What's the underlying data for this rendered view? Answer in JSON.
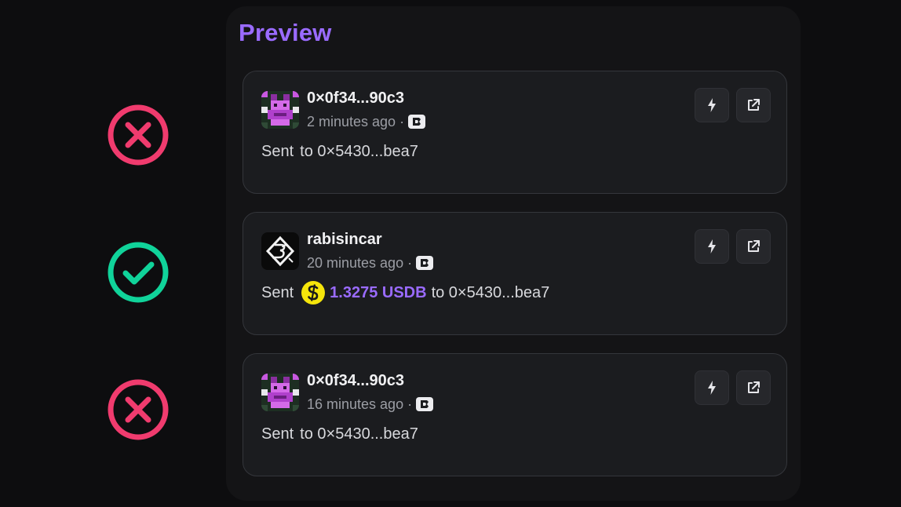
{
  "colors": {
    "accent": "#9a6bff",
    "reject": "#f03b6e",
    "approve": "#10d39a"
  },
  "status_marks": [
    {
      "state": "rejected",
      "icon": "x-circle-icon"
    },
    {
      "state": "approved",
      "icon": "check-circle-icon"
    },
    {
      "state": "rejected",
      "icon": "x-circle-icon"
    }
  ],
  "preview": {
    "title": "Preview",
    "cards": [
      {
        "author": "0×0f34...90c3",
        "time": "2 minutes ago",
        "separator": "·",
        "sent_label": "Sent",
        "amount": "",
        "recipient": "to 0×5430...bea7"
      },
      {
        "author": "rabisincar",
        "time": "20 minutes ago",
        "separator": "·",
        "sent_label": "Sent",
        "amount": "1.3275 USDB",
        "recipient": "to 0×5430...bea7"
      },
      {
        "author": "0×0f34...90c3",
        "time": "16 minutes ago",
        "separator": "·",
        "sent_label": "Sent",
        "amount": "",
        "recipient": "to 0×5430...bea7"
      }
    ]
  }
}
